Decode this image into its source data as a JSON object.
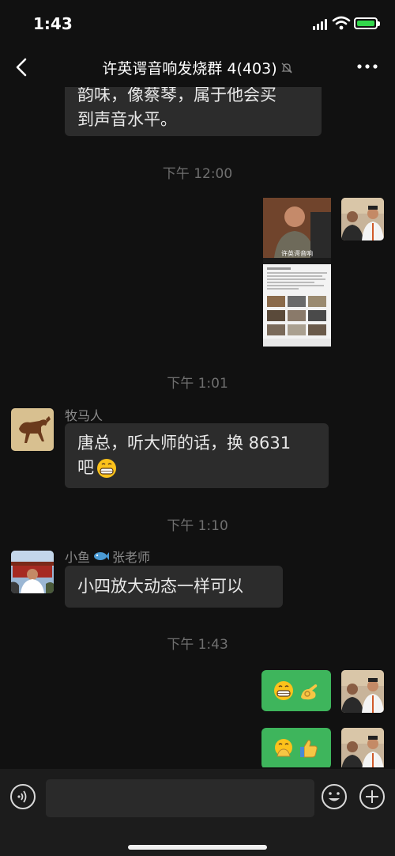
{
  "status_bar": {
    "time": "1:43"
  },
  "header": {
    "title": "许英谔音响发烧群 4(403)"
  },
  "messages": {
    "m0": {
      "text_line1": "韵味，像蔡琴，属于他会买",
      "text_line2": "到声音水平。"
    },
    "ts1": "下午 12:00",
    "ts2": "下午 1:01",
    "m2": {
      "sender": "牧马人",
      "text_line1": "唐总，听大师的话，换 8631",
      "text_line2": "吧"
    },
    "ts3": "下午 1:10",
    "m3": {
      "sender_prefix": "小鱼",
      "sender_suffix": "张老师",
      "text": "小四放大动态一样可以"
    },
    "ts4": "下午 1:43",
    "image_card": {
      "label": "许英谔音响"
    }
  },
  "colors": {
    "own_bubble": "#3eb55c",
    "other_bubble": "#2c2c2c",
    "background": "#111111"
  }
}
